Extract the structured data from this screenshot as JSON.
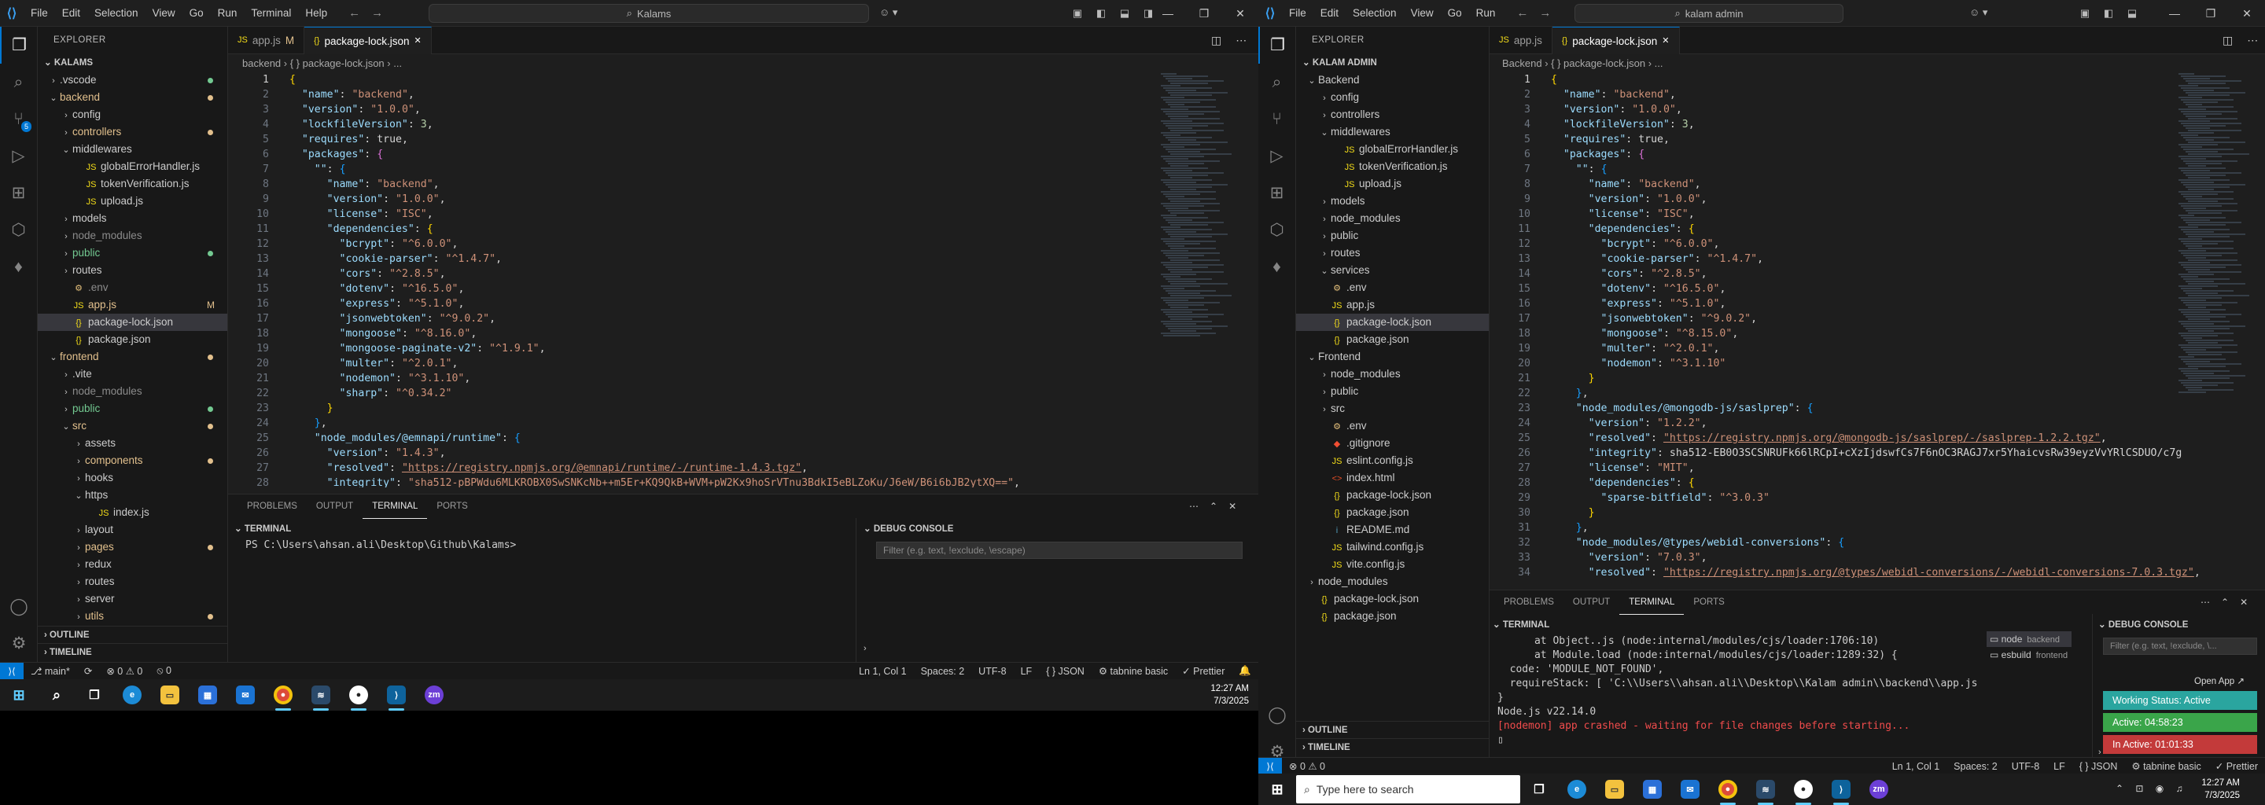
{
  "left": {
    "menu": [
      "File",
      "Edit",
      "Selection",
      "View",
      "Go",
      "Run",
      "Terminal",
      "Help"
    ],
    "command_center": "Kalams",
    "explorer_title": "EXPLORER",
    "workspace": "KALAMS",
    "tabs": [
      {
        "label": "app.js",
        "mod": "M"
      },
      {
        "label": "package-lock.json",
        "mod": ""
      }
    ],
    "breadcrumb": "backend  ›  { }  package-lock.json  ›  ...",
    "tree": [
      {
        "d": 0,
        "c": "›",
        "t": "f",
        "l": ".vscode",
        "dot": true
      },
      {
        "d": 0,
        "c": "⌄",
        "t": "f",
        "l": "backend",
        "dot": true,
        "col": "#e2c08d"
      },
      {
        "d": 1,
        "c": "›",
        "t": "f",
        "l": "config"
      },
      {
        "d": 1,
        "c": "›",
        "t": "f",
        "l": "controllers",
        "dot": true,
        "col": "#e2c08d"
      },
      {
        "d": 1,
        "c": "⌄",
        "t": "f",
        "l": "middlewares"
      },
      {
        "d": 2,
        "c": "",
        "t": "js",
        "l": "globalErrorHandler.js"
      },
      {
        "d": 2,
        "c": "",
        "t": "js",
        "l": "tokenVerification.js"
      },
      {
        "d": 2,
        "c": "",
        "t": "js",
        "l": "upload.js"
      },
      {
        "d": 1,
        "c": "›",
        "t": "f",
        "l": "models"
      },
      {
        "d": 1,
        "c": "›",
        "t": "f",
        "l": "node_modules",
        "col": "#8b8b8b"
      },
      {
        "d": 1,
        "c": "›",
        "t": "f",
        "l": "public",
        "dot": true,
        "col": "#73c991"
      },
      {
        "d": 1,
        "c": "›",
        "t": "f",
        "l": "routes"
      },
      {
        "d": 1,
        "c": "",
        "t": "env",
        "l": ".env",
        "col": "#8b8b8b"
      },
      {
        "d": 1,
        "c": "",
        "t": "js",
        "l": "app.js",
        "st": "M",
        "col": "#e2c08d"
      },
      {
        "d": 1,
        "c": "",
        "t": "json",
        "l": "package-lock.json",
        "sel": true
      },
      {
        "d": 1,
        "c": "",
        "t": "json",
        "l": "package.json"
      },
      {
        "d": 0,
        "c": "⌄",
        "t": "f",
        "l": "frontend",
        "dot": true,
        "col": "#e2c08d"
      },
      {
        "d": 1,
        "c": "›",
        "t": "f",
        "l": ".vite"
      },
      {
        "d": 1,
        "c": "›",
        "t": "f",
        "l": "node_modules",
        "col": "#8b8b8b"
      },
      {
        "d": 1,
        "c": "›",
        "t": "f",
        "l": "public",
        "dot": true,
        "col": "#73c991"
      },
      {
        "d": 1,
        "c": "⌄",
        "t": "f",
        "l": "src",
        "dot": true,
        "col": "#e2c08d"
      },
      {
        "d": 2,
        "c": "›",
        "t": "f",
        "l": "assets"
      },
      {
        "d": 2,
        "c": "›",
        "t": "f",
        "l": "components",
        "dot": true,
        "col": "#e2c08d"
      },
      {
        "d": 2,
        "c": "›",
        "t": "f",
        "l": "hooks"
      },
      {
        "d": 2,
        "c": "⌄",
        "t": "f",
        "l": "https"
      },
      {
        "d": 3,
        "c": "",
        "t": "js",
        "l": "index.js"
      },
      {
        "d": 2,
        "c": "›",
        "t": "f",
        "l": "layout"
      },
      {
        "d": 2,
        "c": "›",
        "t": "f",
        "l": "pages",
        "dot": true,
        "col": "#e2c08d"
      },
      {
        "d": 2,
        "c": "›",
        "t": "f",
        "l": "redux"
      },
      {
        "d": 2,
        "c": "›",
        "t": "f",
        "l": "routes"
      },
      {
        "d": 2,
        "c": "›",
        "t": "f",
        "l": "server"
      },
      {
        "d": 2,
        "c": "›",
        "t": "f",
        "l": "utils",
        "dot": true,
        "col": "#e2c08d"
      }
    ],
    "outline": "OUTLINE",
    "timeline": "TIMELINE",
    "code": [
      [
        "{",
        ""
      ],
      [
        "  \"name\": \"backend\",",
        ""
      ],
      [
        "  \"version\": \"1.0.0\",",
        ""
      ],
      [
        "  \"lockfileVersion\": 3,",
        ""
      ],
      [
        "  \"requires\": true,",
        ""
      ],
      [
        "  \"packages\": {",
        ""
      ],
      [
        "    \"\": {",
        ""
      ],
      [
        "      \"name\": \"backend\",",
        ""
      ],
      [
        "      \"version\": \"1.0.0\",",
        ""
      ],
      [
        "      \"license\": \"ISC\",",
        ""
      ],
      [
        "      \"dependencies\": {",
        ""
      ],
      [
        "        \"bcrypt\": \"^6.0.0\",",
        ""
      ],
      [
        "        \"cookie-parser\": \"^1.4.7\",",
        ""
      ],
      [
        "        \"cors\": \"^2.8.5\",",
        ""
      ],
      [
        "        \"dotenv\": \"^16.5.0\",",
        ""
      ],
      [
        "        \"express\": \"^5.1.0\",",
        ""
      ],
      [
        "        \"jsonwebtoken\": \"^9.0.2\",",
        ""
      ],
      [
        "        \"mongoose\": \"^8.16.0\",",
        ""
      ],
      [
        "        \"mongoose-paginate-v2\": \"^1.9.1\",",
        ""
      ],
      [
        "        \"multer\": \"^2.0.1\",",
        ""
      ],
      [
        "        \"nodemon\": \"^3.1.10\",",
        ""
      ],
      [
        "        \"sharp\": \"^0.34.2\"",
        ""
      ],
      [
        "      }",
        ""
      ],
      [
        "    },",
        ""
      ],
      [
        "    \"node_modules/@emnapi/runtime\": {",
        ""
      ],
      [
        "      \"version\": \"1.4.3\",",
        ""
      ],
      [
        "      \"resolved\": \"https://registry.npmjs.org/@emnapi/runtime/-/runtime-1.4.3.tgz\",",
        ""
      ],
      [
        "      \"integrity\": \"sha512-pBPWdu6MLKROBX0SwSNKcNb++m5Er+KQ9QkB+WVM+pW2Kx9hoSrVTnu3BdkI5eBLZoKu/J6eW/B6i6bJB2ytXQ==\",",
        ""
      ]
    ],
    "panel_tabs": [
      "PROBLEMS",
      "OUTPUT",
      "TERMINAL",
      "PORTS"
    ],
    "terminal_title": "TERMINAL",
    "terminal_lines": [
      "PS C:\\Users\\ahsan.ali\\Desktop\\Github\\Kalams>"
    ],
    "debug_title": "DEBUG CONSOLE",
    "debug_filter": "Filter (e.g. text, !exclude, \\escape)",
    "status_left": [
      "⎇ main*",
      "⟳",
      "⊗ 0 ⚠ 0",
      "⦸ 0"
    ],
    "status_right": [
      "Ln 1, Col 1",
      "Spaces: 2",
      "UTF-8",
      "LF",
      "{ } JSON",
      "⚙ tabnine basic",
      "✓ Prettier",
      "🔔"
    ],
    "clock_time": "12:27 AM",
    "clock_date": "7/3/2025"
  },
  "right": {
    "menu": [
      "File",
      "Edit",
      "Selection",
      "View",
      "Go",
      "Run"
    ],
    "command_center": "kalam admin",
    "explorer_title": "EXPLORER",
    "workspace": "KALAM ADMIN",
    "tabs": [
      {
        "label": "app.js",
        "mod": ""
      },
      {
        "label": "package-lock.json",
        "mod": ""
      }
    ],
    "breadcrumb": "Backend  ›  { }  package-lock.json  ›  ...",
    "tree": [
      {
        "d": 0,
        "c": "⌄",
        "t": "f",
        "l": "Backend"
      },
      {
        "d": 1,
        "c": "›",
        "t": "f",
        "l": "config"
      },
      {
        "d": 1,
        "c": "›",
        "t": "f",
        "l": "controllers"
      },
      {
        "d": 1,
        "c": "⌄",
        "t": "f",
        "l": "middlewares"
      },
      {
        "d": 2,
        "c": "",
        "t": "js",
        "l": "globalErrorHandler.js"
      },
      {
        "d": 2,
        "c": "",
        "t": "js",
        "l": "tokenVerification.js"
      },
      {
        "d": 2,
        "c": "",
        "t": "js",
        "l": "upload.js"
      },
      {
        "d": 1,
        "c": "›",
        "t": "f",
        "l": "models"
      },
      {
        "d": 1,
        "c": "›",
        "t": "f",
        "l": "node_modules"
      },
      {
        "d": 1,
        "c": "›",
        "t": "f",
        "l": "public"
      },
      {
        "d": 1,
        "c": "›",
        "t": "f",
        "l": "routes"
      },
      {
        "d": 1,
        "c": "⌄",
        "t": "f",
        "l": "services"
      },
      {
        "d": 1,
        "c": "",
        "t": "env",
        "l": ".env"
      },
      {
        "d": 1,
        "c": "",
        "t": "js",
        "l": "app.js"
      },
      {
        "d": 1,
        "c": "",
        "t": "json",
        "l": "package-lock.json",
        "sel": true
      },
      {
        "d": 1,
        "c": "",
        "t": "json",
        "l": "package.json"
      },
      {
        "d": 0,
        "c": "⌄",
        "t": "f",
        "l": "Frontend"
      },
      {
        "d": 1,
        "c": "›",
        "t": "f",
        "l": "node_modules"
      },
      {
        "d": 1,
        "c": "›",
        "t": "f",
        "l": "public"
      },
      {
        "d": 1,
        "c": "›",
        "t": "f",
        "l": "src"
      },
      {
        "d": 1,
        "c": "",
        "t": "env",
        "l": ".env"
      },
      {
        "d": 1,
        "c": "",
        "t": "git",
        "l": ".gitignore"
      },
      {
        "d": 1,
        "c": "",
        "t": "js",
        "l": "eslint.config.js"
      },
      {
        "d": 1,
        "c": "",
        "t": "html",
        "l": "index.html"
      },
      {
        "d": 1,
        "c": "",
        "t": "json",
        "l": "package-lock.json"
      },
      {
        "d": 1,
        "c": "",
        "t": "json",
        "l": "package.json"
      },
      {
        "d": 1,
        "c": "",
        "t": "md",
        "l": "README.md"
      },
      {
        "d": 1,
        "c": "",
        "t": "js",
        "l": "tailwind.config.js"
      },
      {
        "d": 1,
        "c": "",
        "t": "js",
        "l": "vite.config.js"
      },
      {
        "d": 0,
        "c": "›",
        "t": "f",
        "l": "node_modules"
      },
      {
        "d": 0,
        "c": "",
        "t": "json",
        "l": "package-lock.json"
      },
      {
        "d": 0,
        "c": "",
        "t": "json",
        "l": "package.json"
      }
    ],
    "outline": "OUTLINE",
    "timeline": "TIMELINE",
    "code": [
      [
        "{",
        ""
      ],
      [
        "  \"name\": \"backend\",",
        ""
      ],
      [
        "  \"version\": \"1.0.0\",",
        ""
      ],
      [
        "  \"lockfileVersion\": 3,",
        ""
      ],
      [
        "  \"requires\": true,",
        ""
      ],
      [
        "  \"packages\": {",
        ""
      ],
      [
        "    \"\": {",
        ""
      ],
      [
        "      \"name\": \"backend\",",
        ""
      ],
      [
        "      \"version\": \"1.0.0\",",
        ""
      ],
      [
        "      \"license\": \"ISC\",",
        ""
      ],
      [
        "      \"dependencies\": {",
        ""
      ],
      [
        "        \"bcrypt\": \"^6.0.0\",",
        ""
      ],
      [
        "        \"cookie-parser\": \"^1.4.7\",",
        ""
      ],
      [
        "        \"cors\": \"^2.8.5\",",
        ""
      ],
      [
        "        \"dotenv\": \"^16.5.0\",",
        ""
      ],
      [
        "        \"express\": \"^5.1.0\",",
        ""
      ],
      [
        "        \"jsonwebtoken\": \"^9.0.2\",",
        ""
      ],
      [
        "        \"mongoose\": \"^8.15.0\",",
        ""
      ],
      [
        "        \"multer\": \"^2.0.1\",",
        ""
      ],
      [
        "        \"nodemon\": \"^3.1.10\"",
        ""
      ],
      [
        "      }",
        ""
      ],
      [
        "    },",
        ""
      ],
      [
        "    \"node_modules/@mongodb-js/saslprep\": {",
        ""
      ],
      [
        "      \"version\": \"1.2.2\",",
        ""
      ],
      [
        "      \"resolved\": \"https://registry.npmjs.org/@mongodb-js/saslprep/-/saslprep-1.2.2.tgz\",",
        ""
      ],
      [
        "      \"integrity\": \"sha512-EB0O3SCSNRUFk66lRCpI+cXzIjdswfCs7F6nOC3RAGJ7xr5YhaicvsRw39eyzVvYRlCSDUO/c7g",
        ""
      ],
      [
        "      \"license\": \"MIT\",",
        ""
      ],
      [
        "      \"dependencies\": {",
        ""
      ],
      [
        "        \"sparse-bitfield\": \"^3.0.3\"",
        ""
      ],
      [
        "      }",
        ""
      ],
      [
        "    },",
        ""
      ],
      [
        "    \"node_modules/@types/webidl-conversions\": {",
        ""
      ],
      [
        "      \"version\": \"7.0.3\",",
        ""
      ],
      [
        "      \"resolved\": \"https://registry.npmjs.org/@types/webidl-conversions/-/webidl-conversions-7.0.3.tgz\",",
        ""
      ]
    ],
    "panel_tabs": [
      "PROBLEMS",
      "OUTPUT",
      "TERMINAL",
      "PORTS"
    ],
    "terminal_title": "TERMINAL",
    "terminal_lines": [
      "      at Object..js (node:internal/modules/cjs/loader:1706:10)",
      "      at Module.load (node:internal/modules/cjs/loader:1289:32) {",
      "  code: 'MODULE_NOT_FOUND',",
      "  requireStack: [ 'C:\\\\Users\\\\ahsan.ali\\\\Desktop\\\\Kalam admin\\\\backend\\\\app.js' ]",
      "}",
      "",
      "Node.js v22.14.0",
      "[nodemon] app crashed - waiting for file changes before starting...",
      "▯"
    ],
    "term_list": [
      {
        "name": "node",
        "sub": "backend"
      },
      {
        "name": "esbuild",
        "sub": "frontend"
      }
    ],
    "debug_title": "DEBUG CONSOLE",
    "debug_filter": "Filter (e.g. text, !exclude, \\...",
    "open_app": "Open App ↗",
    "pills": [
      {
        "text": "Working Status: Active",
        "color": "#2aa59f"
      },
      {
        "text": "Active: 04:58:23",
        "color": "#3aa54a"
      },
      {
        "text": "In Active: 01:01:33",
        "color": "#c33a3a"
      }
    ],
    "status_left": [
      "⊗ 0 ⚠ 0"
    ],
    "status_right": [
      "Ln 1, Col 1",
      "Spaces: 2",
      "UTF-8",
      "LF",
      "{ } JSON",
      "⚙ tabnine basic",
      "✓ Prettier"
    ],
    "search_placeholder": "Type here to search",
    "clock_time": "12:27 AM",
    "clock_date": "7/3/2025"
  }
}
